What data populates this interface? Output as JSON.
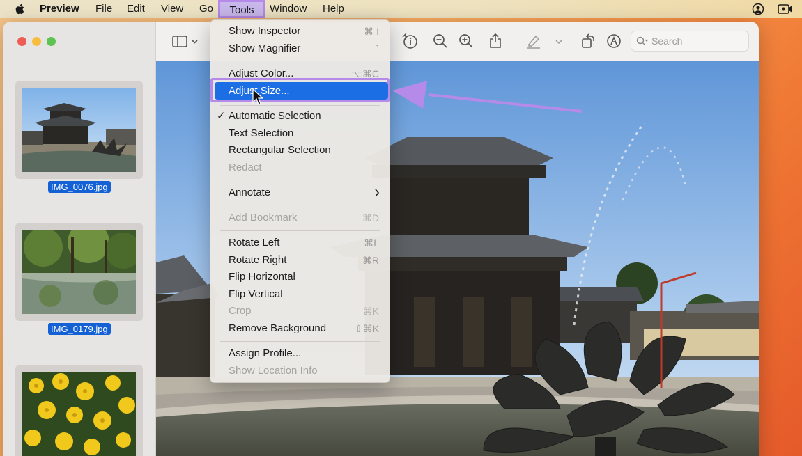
{
  "menubar": {
    "app": "Preview",
    "file": "File",
    "edit": "Edit",
    "view": "View",
    "go": "Go",
    "tools": "Tools",
    "window": "Window",
    "help": "Help"
  },
  "sidebar": {
    "thumbnails": [
      {
        "label": "IMG_0076.jpg"
      },
      {
        "label": "IMG_0179.jpg"
      },
      {
        "label": ""
      }
    ]
  },
  "toolbar": {
    "search_placeholder": "Search"
  },
  "tools_menu": {
    "items": [
      {
        "label": "Show Inspector",
        "shortcut": "⌘ I",
        "enabled": true
      },
      {
        "label": "Show Magnifier",
        "shortcut": "`",
        "enabled": true
      },
      {
        "label": "Adjust Color...",
        "shortcut": "⌥⌘C",
        "enabled": true
      },
      {
        "label": "Adjust Size...",
        "shortcut": "",
        "enabled": true,
        "selected": true
      },
      {
        "label": "Automatic Selection",
        "shortcut": "",
        "enabled": true,
        "checked": true
      },
      {
        "label": "Text Selection",
        "shortcut": "",
        "enabled": true
      },
      {
        "label": "Rectangular Selection",
        "shortcut": "",
        "enabled": true
      },
      {
        "label": "Redact",
        "shortcut": "",
        "enabled": false
      },
      {
        "label": "Annotate",
        "shortcut": "",
        "enabled": true,
        "submenu": true
      },
      {
        "label": "Add Bookmark",
        "shortcut": "⌘D",
        "enabled": false
      },
      {
        "label": "Rotate Left",
        "shortcut": "⌘L",
        "enabled": true
      },
      {
        "label": "Rotate Right",
        "shortcut": "⌘R",
        "enabled": true
      },
      {
        "label": "Flip Horizontal",
        "shortcut": "",
        "enabled": true
      },
      {
        "label": "Flip Vertical",
        "shortcut": "",
        "enabled": true
      },
      {
        "label": "Crop",
        "shortcut": "⌘K",
        "enabled": false
      },
      {
        "label": "Remove Background",
        "shortcut": "⇧⌘K",
        "enabled": true
      },
      {
        "label": "Assign Profile...",
        "shortcut": "",
        "enabled": true
      },
      {
        "label": "Show Location Info",
        "shortcut": "",
        "enabled": false
      }
    ]
  },
  "colors": {
    "highlight": "#b58ae8",
    "selection_blue": "#1c6ee5"
  }
}
